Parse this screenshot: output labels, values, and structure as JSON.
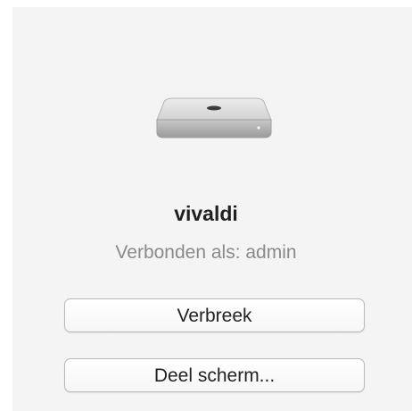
{
  "device": {
    "icon": "mac-mini-icon",
    "name": "vivaldi",
    "status": "Verbonden als: admin"
  },
  "actions": {
    "disconnect_label": "Verbreek",
    "share_screen_label": "Deel scherm..."
  }
}
